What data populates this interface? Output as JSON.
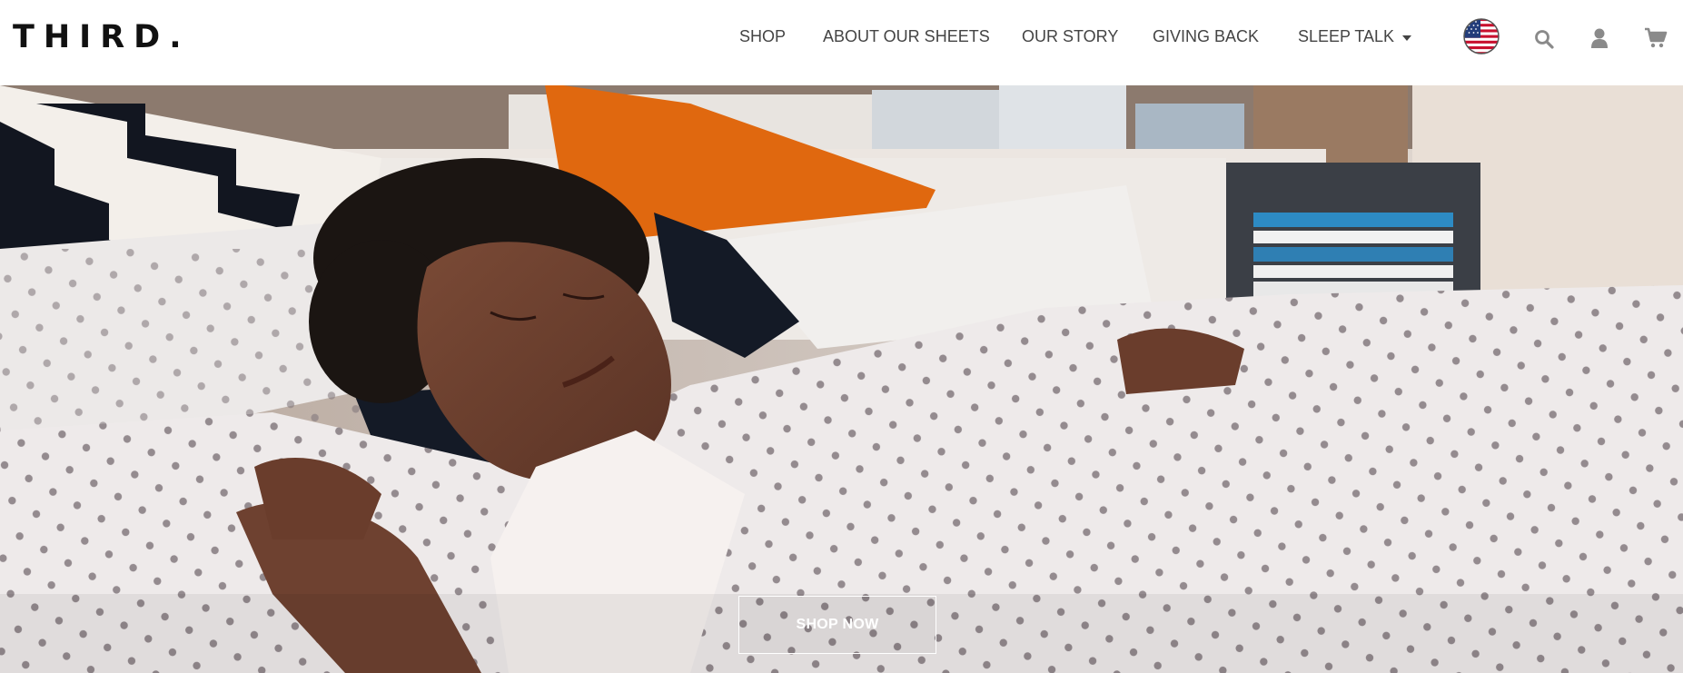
{
  "header": {
    "logo": "THIRD.",
    "nav": [
      {
        "label": "SHOP"
      },
      {
        "label": "ABOUT OUR SHEETS"
      },
      {
        "label": "OUR STORY"
      },
      {
        "label": "GIVING BACK"
      },
      {
        "label": "SLEEP TALK"
      }
    ],
    "icons": [
      "us-flag-icon",
      "search-icon",
      "account-icon",
      "cart-icon"
    ]
  },
  "hero": {
    "cta_label": "SHOP NOW"
  },
  "colors": {
    "nav_text": "#444444",
    "logo": "#111111",
    "icon_gray": "#8a8a8a",
    "pillow_orange": "#e0680f"
  }
}
